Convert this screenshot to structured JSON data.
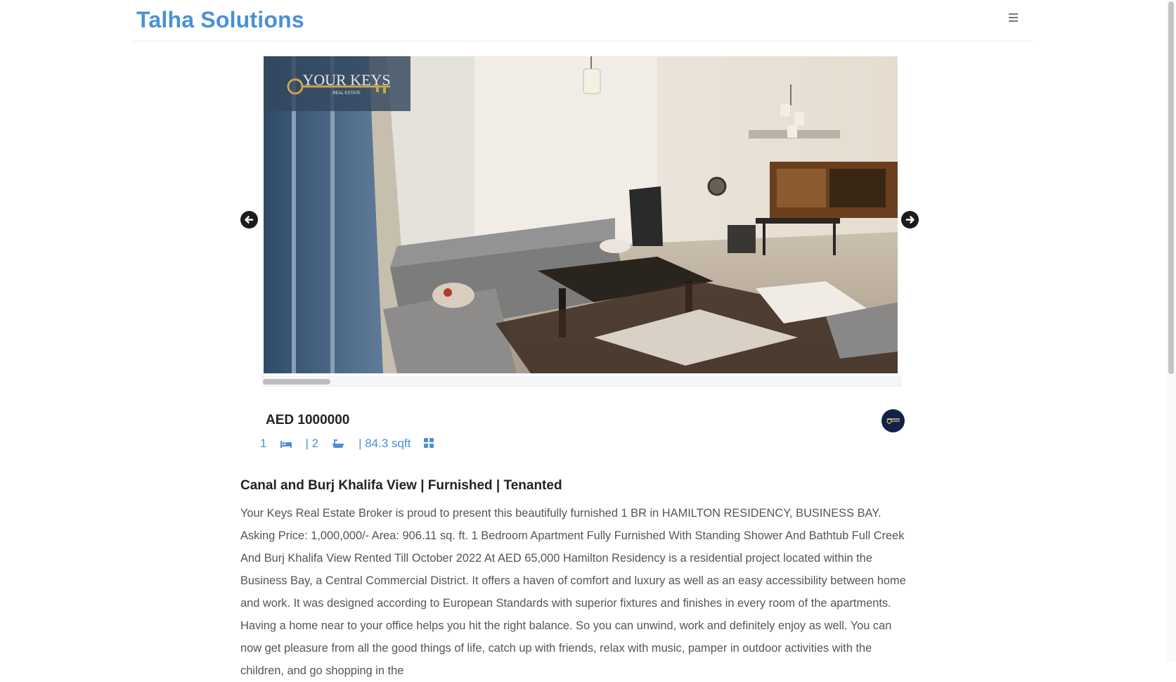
{
  "navbar": {
    "brand": "Talha Solutions",
    "menu_icon": "hamburger-menu-icon"
  },
  "gallery": {
    "watermark_text": "YOUR KEYS",
    "watermark_subtext": "REAL ESTATE",
    "prev_icon": "arrow-left-icon",
    "next_icon": "arrow-right-icon"
  },
  "listing": {
    "price": "AED 1000000",
    "bedrooms": "1",
    "bathrooms": "| 2",
    "area": "| 84.3 sqft",
    "title": "Canal and Burj Khalifa View | Furnished | Tenanted",
    "description": "Your Keys Real Estate Broker is proud to present this beautifully furnished 1 BR in HAMILTON RESIDENCY, BUSINESS BAY. Asking Price: 1,000,000/- Area: 906.11 sq. ft. 1 Bedroom Apartment Fully Furnished With Standing Shower And Bathtub Full Creek And Burj Khalifa View Rented Till October 2022 At AED 65,000 Hamilton Residency is a residential project located within the Business Bay, a Central Commercial District. It offers a haven of comfort and luxury as well as an easy accessibility between home and work. It was designed according to European Standards with superior fixtures and finishes in every room of the apartments. Having a home near to your office helps you hit the right balance. So you can unwind, work and definitely enjoy as well. You can now get pleasure from all the good things of life, catch up with friends, relax with music, pamper in outdoor activities with the children, and go shopping in the"
  },
  "icons": {
    "bed": "bed-icon",
    "bath": "bath-icon",
    "area": "grid-area-icon"
  },
  "colors": {
    "brand": "#4a90d9",
    "text": "#555555",
    "heading": "#222222"
  }
}
